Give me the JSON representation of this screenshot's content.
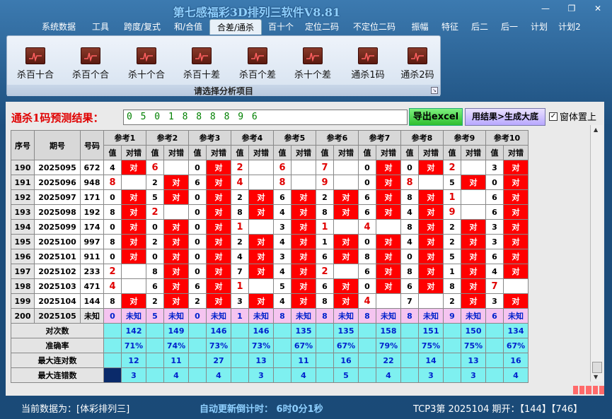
{
  "window": {
    "title": "第七感福彩3D排列三软件V8.81"
  },
  "menu": [
    "系统数据",
    "工具",
    "跨度/复式",
    "和/合值",
    "合差/通杀",
    "百十个",
    "定位二码",
    "不定位二码",
    "振幅",
    "特征",
    "后二",
    "后一",
    "计划",
    "计划2"
  ],
  "active_menu": "合差/通杀",
  "ribbon": {
    "buttons": [
      "杀百十合",
      "杀百个合",
      "杀十个合",
      "杀百十差",
      "杀百个差",
      "杀十个差",
      "通杀1码",
      "通杀2码"
    ],
    "caption": "请选择分析项目"
  },
  "prediction": {
    "label": "通杀1码预测结果：",
    "value": "0 5 0 1 8 8 8 8 9 6",
    "excel_button": "导出excel",
    "generate_button": "用结果>生成大底",
    "topmost_label": "窗体置上",
    "topmost_checked": true
  },
  "table": {
    "headers": {
      "index": "序号",
      "period": "期号",
      "number": "号码",
      "refs": [
        "参考1",
        "参考2",
        "参考3",
        "参考4",
        "参考5",
        "参考6",
        "参考7",
        "参考8",
        "参考9",
        "参考10"
      ],
      "value": "值",
      "result": "对错"
    },
    "hit_text": "对",
    "rows": [
      {
        "idx": "190",
        "period": "2025095",
        "num": "672",
        "vals": [
          "4",
          "6",
          "0",
          "2",
          "6",
          "7",
          "0",
          "0",
          "2",
          "3"
        ],
        "hits": [
          1,
          0,
          1,
          0,
          0,
          0,
          1,
          1,
          0,
          1
        ],
        "reds": [
          0,
          1,
          0,
          1,
          1,
          1,
          0,
          0,
          1,
          0
        ]
      },
      {
        "idx": "191",
        "period": "2025096",
        "num": "948",
        "vals": [
          "8",
          "2",
          "6",
          "4",
          "8",
          "9",
          "0",
          "8",
          "5",
          "0"
        ],
        "hits": [
          0,
          1,
          1,
          0,
          0,
          0,
          1,
          0,
          1,
          1
        ],
        "reds": [
          1,
          0,
          0,
          1,
          1,
          1,
          0,
          1,
          0,
          0
        ]
      },
      {
        "idx": "192",
        "period": "2025097",
        "num": "171",
        "vals": [
          "0",
          "5",
          "0",
          "2",
          "6",
          "2",
          "6",
          "8",
          "1",
          "6"
        ],
        "hits": [
          1,
          1,
          1,
          1,
          1,
          1,
          1,
          1,
          0,
          1
        ],
        "reds": [
          0,
          0,
          0,
          0,
          0,
          0,
          0,
          0,
          1,
          0
        ]
      },
      {
        "idx": "193",
        "period": "2025098",
        "num": "192",
        "vals": [
          "8",
          "2",
          "0",
          "8",
          "4",
          "8",
          "6",
          "4",
          "9",
          "6"
        ],
        "hits": [
          1,
          0,
          1,
          1,
          1,
          1,
          1,
          1,
          0,
          1
        ],
        "reds": [
          0,
          1,
          0,
          0,
          0,
          0,
          0,
          0,
          1,
          0
        ]
      },
      {
        "idx": "194",
        "period": "2025099",
        "num": "174",
        "vals": [
          "0",
          "0",
          "0",
          "1",
          "3",
          "1",
          "4",
          "8",
          "2",
          "3"
        ],
        "hits": [
          1,
          1,
          1,
          0,
          1,
          0,
          0,
          1,
          1,
          1
        ],
        "reds": [
          0,
          0,
          0,
          1,
          0,
          1,
          1,
          0,
          0,
          0
        ]
      },
      {
        "idx": "195",
        "period": "2025100",
        "num": "997",
        "vals": [
          "8",
          "2",
          "0",
          "2",
          "4",
          "1",
          "0",
          "4",
          "2",
          "3"
        ],
        "hits": [
          1,
          1,
          1,
          1,
          1,
          1,
          1,
          1,
          1,
          1
        ],
        "reds": [
          0,
          0,
          0,
          0,
          0,
          0,
          0,
          0,
          0,
          0
        ]
      },
      {
        "idx": "196",
        "period": "2025101",
        "num": "911",
        "vals": [
          "0",
          "0",
          "0",
          "4",
          "3",
          "6",
          "8",
          "0",
          "5",
          "6"
        ],
        "hits": [
          1,
          1,
          1,
          1,
          1,
          1,
          1,
          1,
          1,
          1
        ],
        "reds": [
          0,
          0,
          0,
          0,
          0,
          0,
          0,
          0,
          0,
          0
        ]
      },
      {
        "idx": "197",
        "period": "2025102",
        "num": "233",
        "vals": [
          "2",
          "8",
          "0",
          "7",
          "4",
          "2",
          "6",
          "8",
          "1",
          "4"
        ],
        "hits": [
          0,
          1,
          1,
          1,
          1,
          0,
          1,
          1,
          1,
          1
        ],
        "reds": [
          1,
          0,
          0,
          0,
          0,
          1,
          0,
          0,
          0,
          0
        ]
      },
      {
        "idx": "198",
        "period": "2025103",
        "num": "471",
        "vals": [
          "4",
          "6",
          "6",
          "1",
          "5",
          "6",
          "0",
          "6",
          "8",
          "7"
        ],
        "hits": [
          0,
          1,
          1,
          0,
          1,
          1,
          1,
          1,
          1,
          0
        ],
        "reds": [
          1,
          0,
          0,
          1,
          0,
          0,
          0,
          0,
          0,
          1
        ]
      },
      {
        "idx": "199",
        "period": "2025104",
        "num": "144",
        "vals": [
          "8",
          "2",
          "2",
          "3",
          "4",
          "8",
          "4",
          "7",
          "2",
          "3"
        ],
        "hits": [
          1,
          1,
          1,
          1,
          1,
          1,
          0,
          0,
          1,
          1
        ],
        "reds": [
          0,
          0,
          0,
          0,
          0,
          0,
          1,
          0,
          0,
          0
        ]
      }
    ],
    "prediction_row": {
      "idx": "200",
      "period": "2025105",
      "num": "未知",
      "vals": [
        "0",
        "5",
        "0",
        "1",
        "8",
        "8",
        "8",
        "8",
        "9",
        "6"
      ],
      "result": "未知"
    },
    "stats": [
      {
        "label": "对次数",
        "values": [
          "142",
          "149",
          "146",
          "146",
          "135",
          "135",
          "158",
          "151",
          "150",
          "134"
        ]
      },
      {
        "label": "准确率",
        "values": [
          "71%",
          "74%",
          "73%",
          "73%",
          "67%",
          "67%",
          "79%",
          "75%",
          "75%",
          "67%"
        ]
      },
      {
        "label": "最大连对数",
        "values": [
          "12",
          "11",
          "27",
          "13",
          "11",
          "16",
          "22",
          "14",
          "13",
          "16"
        ]
      },
      {
        "label": "最大连错数",
        "values": [
          "3",
          "4",
          "4",
          "3",
          "4",
          "5",
          "4",
          "3",
          "3",
          "4"
        ]
      }
    ]
  },
  "status": {
    "data_source": "当前数据为：[体彩排列三]",
    "countdown": "自动更新倒计时：  6时0分1秒",
    "last_draw": "TCP3第 2025104 期开：【144】【746】"
  },
  "colors": {
    "hit": "#ff0000",
    "stat_bg": "#7ef0f0",
    "pred_bg": "#f5c4f0",
    "accent_text": "#e00000"
  }
}
